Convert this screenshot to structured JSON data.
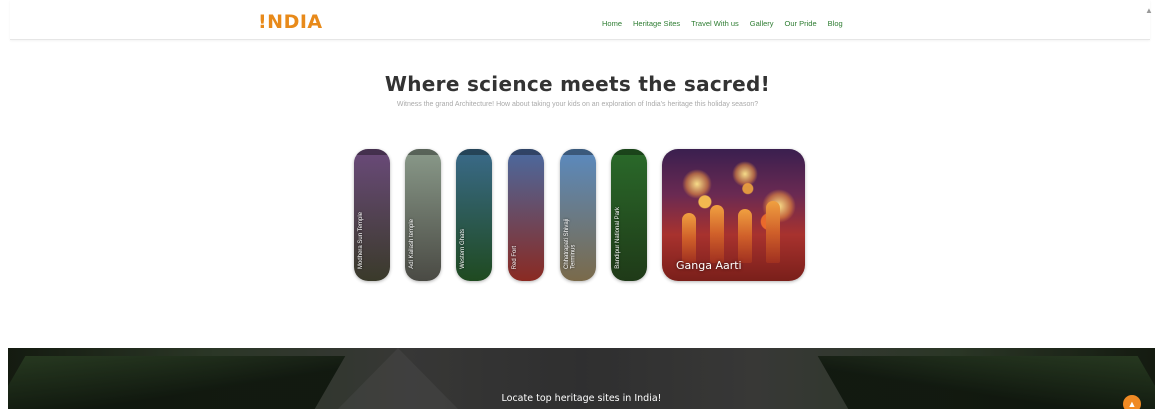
{
  "header": {
    "logo": "!NDIA",
    "nav": [
      "Home",
      "Heritage Sites",
      "Travel With us",
      "Gallery",
      "Our Pride",
      "Blog"
    ]
  },
  "hero": {
    "title": "Where science meets the sacred!",
    "subtitle": "Witness the grand Architecture! How about taking your kids on an exploration of India's heritage this holiday season?"
  },
  "gallery": {
    "strips": [
      {
        "label": "Modhera Sun Temple",
        "color_top": "#6a4a7a",
        "color_bottom": "#3a3a2a"
      },
      {
        "label": "Adi Kailash temple",
        "color_top": "#8a9a8a",
        "color_bottom": "#4a4a44"
      },
      {
        "label": "Western Ghats",
        "color_top": "#3a6a8a",
        "color_bottom": "#1f4a20"
      },
      {
        "label": "Red Fort",
        "color_top": "#4a6aa0",
        "color_bottom": "#8a2a22"
      },
      {
        "label": "Chhatrapati Shivaji Terminus",
        "color_top": "#5a8ac0",
        "color_bottom": "#7a6a4a"
      },
      {
        "label": "Bandipur National Park",
        "color_top": "#2a6a2a",
        "color_bottom": "#1f3a18"
      }
    ],
    "featured": {
      "label": "Ganga Aarti"
    }
  },
  "banner": {
    "text": "Locate top heritage sites in India!"
  },
  "colors": {
    "accent": "#e88a1a",
    "nav": "#2e7d32",
    "fab": "#f08a24"
  }
}
